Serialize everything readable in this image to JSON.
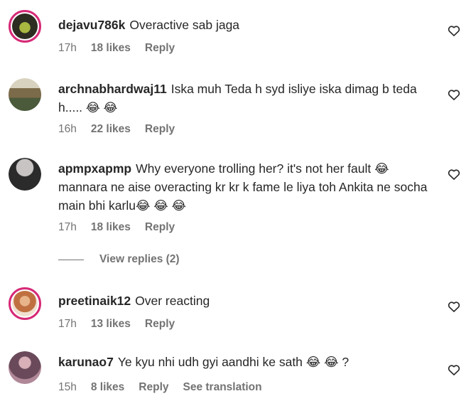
{
  "comments": [
    {
      "username": "dejavu786k",
      "text": "Overactive sab jaga",
      "time": "17h",
      "likes": "18 likes",
      "reply": "Reply",
      "avatar_color": "#3b3a2a"
    },
    {
      "username": "archnabhardwaj11",
      "text": "Iska muh Teda h syd isliye iska dimag b teda h.....",
      "emoji": "😂 😂",
      "time": "16h",
      "likes": "22 likes",
      "reply": "Reply",
      "avatar_color": "#8a7b5c"
    },
    {
      "username": "apmpxapmp",
      "text": "Why everyone trolling her? it's not her fault 😂 mannara ne aise overacting kr kr k fame le liya toh Ankita ne socha main bhi karlu😂 😂 😂",
      "time": "17h",
      "likes": "18 likes",
      "reply": "Reply",
      "avatar_color": "#2a2a2a"
    },
    {
      "username": "preetinaik12",
      "text": "Over reacting",
      "time": "17h",
      "likes": "13 likes",
      "reply": "Reply",
      "avatar_color": "#c9884a"
    },
    {
      "username": "karunao7",
      "text": "Ye kyu nhi udh gyi aandhi ke sath 😂 😂 ?",
      "time": "15h",
      "likes": "8 likes",
      "reply": "Reply",
      "translation": "See translation",
      "avatar_color": "#7a5a6a"
    }
  ],
  "view_replies": "View replies (2)",
  "icons": {
    "like": "heart-icon"
  }
}
